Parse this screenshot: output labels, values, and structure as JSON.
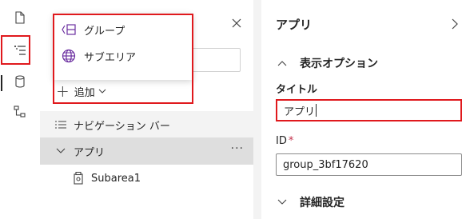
{
  "popup_menu": {
    "items": [
      {
        "label": "グループ",
        "icon": "group-icon"
      },
      {
        "label": "サブエリア",
        "icon": "globe-icon"
      }
    ]
  },
  "tree": {
    "add_label": "追加",
    "rows": [
      {
        "label": "ナビゲーション バー",
        "icon": "list-icon"
      },
      {
        "label": "アプリ",
        "icon": "chevron-down-icon",
        "more": "···"
      },
      {
        "label": "Subarea1",
        "icon": "subarea-icon"
      }
    ]
  },
  "props": {
    "title": "アプリ",
    "section_display": "表示オプション",
    "title_label": "タイトル",
    "title_value": "アプリ",
    "id_label": "ID",
    "id_required": "*",
    "id_value": "group_3bf17620",
    "section_detail": "詳細設定"
  },
  "colors": {
    "highlight_border": "#e0191d",
    "selected_row": "#dedede",
    "nav_row": "#f3f3f3"
  }
}
